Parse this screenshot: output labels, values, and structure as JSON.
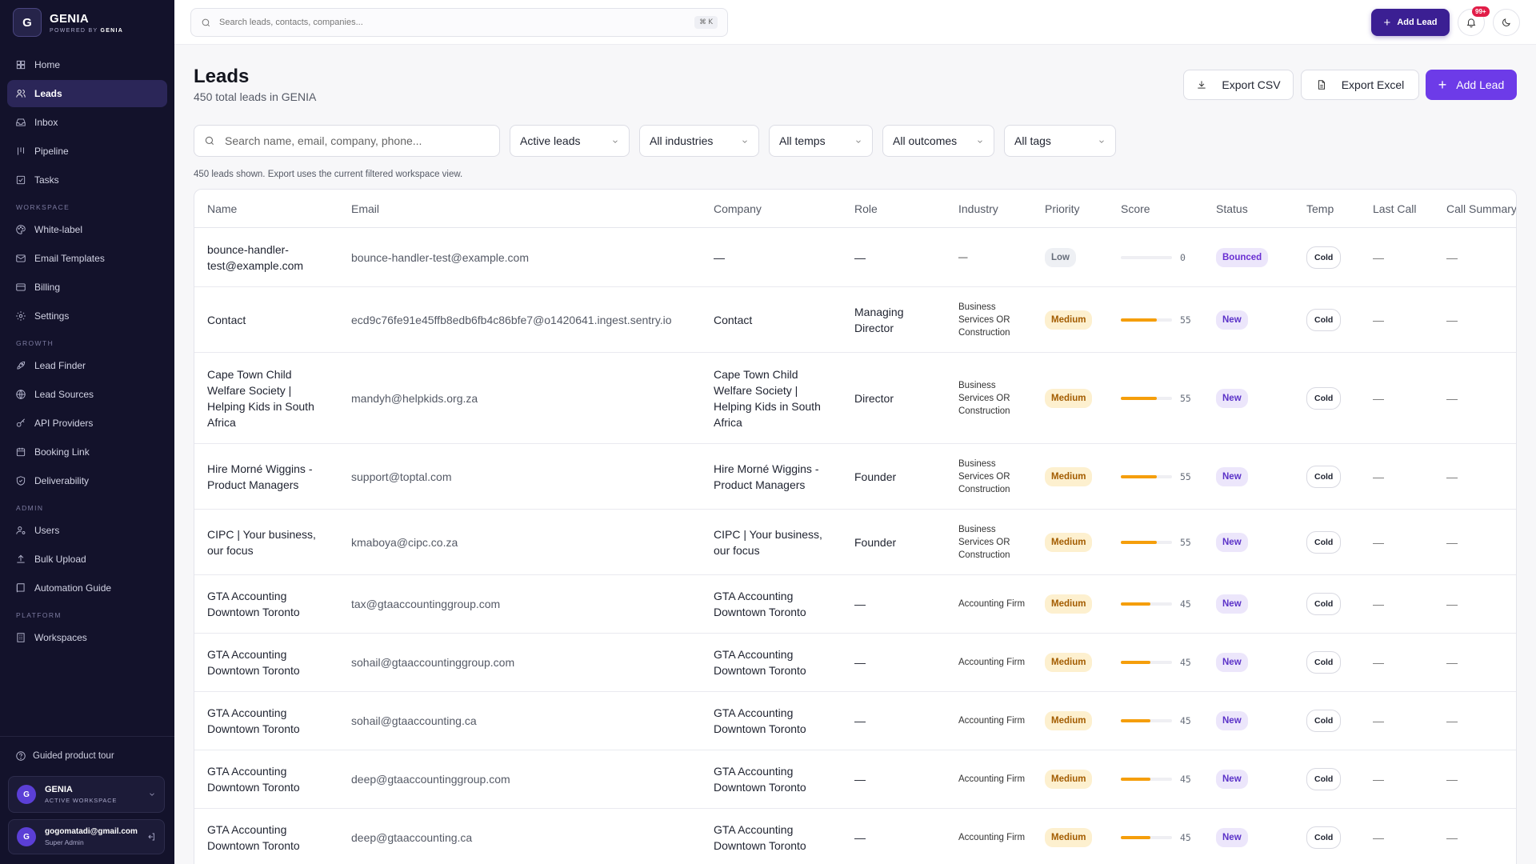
{
  "brand": {
    "logo_letter": "G",
    "name": "GENIA",
    "powered_by": "POWERED BY",
    "powered_brand": "GENIA"
  },
  "nav": {
    "main": [
      {
        "label": "Home",
        "icon": "grid-icon"
      },
      {
        "label": "Leads",
        "icon": "users-icon",
        "active": true
      },
      {
        "label": "Inbox",
        "icon": "inbox-icon"
      },
      {
        "label": "Pipeline",
        "icon": "pipeline-icon"
      },
      {
        "label": "Tasks",
        "icon": "task-check-icon"
      }
    ],
    "sections": [
      {
        "title": "WORKSPACE",
        "items": [
          {
            "label": "White-label",
            "icon": "palette-icon"
          },
          {
            "label": "Email Templates",
            "icon": "mail-icon"
          },
          {
            "label": "Billing",
            "icon": "card-icon"
          },
          {
            "label": "Settings",
            "icon": "gear-icon"
          }
        ]
      },
      {
        "title": "GROWTH",
        "items": [
          {
            "label": "Lead Finder",
            "icon": "rocket-icon"
          },
          {
            "label": "Lead Sources",
            "icon": "globe-icon"
          },
          {
            "label": "API Providers",
            "icon": "key-icon"
          },
          {
            "label": "Booking Link",
            "icon": "calendar-icon"
          },
          {
            "label": "Deliverability",
            "icon": "shield-icon"
          }
        ]
      },
      {
        "title": "ADMIN",
        "items": [
          {
            "label": "Users",
            "icon": "user-cog-icon"
          },
          {
            "label": "Bulk Upload",
            "icon": "upload-icon"
          },
          {
            "label": "Automation Guide",
            "icon": "book-icon"
          }
        ]
      },
      {
        "title": "PLATFORM",
        "items": [
          {
            "label": "Workspaces",
            "icon": "building-icon"
          }
        ]
      }
    ]
  },
  "sidebar_footer": {
    "tour_label": "Guided product tour",
    "workspace": {
      "avatar": "G",
      "name": "GENIA",
      "sub": "ACTIVE WORKSPACE"
    },
    "user": {
      "avatar": "G",
      "email": "gogomatadi@gmail.com",
      "role": "Super Admin"
    }
  },
  "topbar": {
    "search_placeholder": "Search leads, contacts, companies...",
    "shortcut": "⌘ K",
    "add_lead": "Add Lead",
    "notif_badge": "99+"
  },
  "page": {
    "title": "Leads",
    "subtitle": "450 total leads in GENIA",
    "export_csv": "Export CSV",
    "export_excel": "Export Excel",
    "add_lead": "Add Lead",
    "search_placeholder": "Search name, email, company, phone...",
    "filters": [
      "Active leads",
      "All industries",
      "All temps",
      "All outcomes",
      "All tags"
    ],
    "hint": "450 leads shown. Export uses the current filtered workspace view."
  },
  "table": {
    "columns": [
      "Name",
      "Email",
      "Company",
      "Role",
      "Industry",
      "Priority",
      "Score",
      "Status",
      "Temp",
      "Last Call",
      "Call Summary"
    ],
    "rows": [
      {
        "name": "bounce-handler-test@example.com",
        "email": "bounce-handler-test@example.com",
        "company": "—",
        "role": "—",
        "industry": "—",
        "priority": "Low",
        "score": 0,
        "status": "Bounced",
        "temp": "Cold",
        "last_call": "—",
        "summary": "—"
      },
      {
        "name": "Contact",
        "email": "ecd9c76fe91e45ffb8edb6fb4c86bfe7@o1420641.ingest.sentry.io",
        "company": "Contact",
        "role": "Managing Director",
        "industry": "Business Services OR Construction",
        "priority": "Medium",
        "score": 55,
        "status": "New",
        "temp": "Cold",
        "last_call": "—",
        "summary": "—"
      },
      {
        "name": "Cape Town Child Welfare Society | Helping Kids in South Africa",
        "email": "mandyh@helpkids.org.za",
        "company": "Cape Town Child Welfare Society | Helping Kids in South Africa",
        "role": "Director",
        "industry": "Business Services OR Construction",
        "priority": "Medium",
        "score": 55,
        "status": "New",
        "temp": "Cold",
        "last_call": "—",
        "summary": "—"
      },
      {
        "name": "Hire Morné Wiggins - Product Managers",
        "email": "support@toptal.com",
        "company": "Hire Morné Wiggins - Product Managers",
        "role": "Founder",
        "industry": "Business Services OR Construction",
        "priority": "Medium",
        "score": 55,
        "status": "New",
        "temp": "Cold",
        "last_call": "—",
        "summary": "—"
      },
      {
        "name": "CIPC | Your business, our focus",
        "email": "kmaboya@cipc.co.za",
        "company": "CIPC | Your business, our focus",
        "role": "Founder",
        "industry": "Business Services OR Construction",
        "priority": "Medium",
        "score": 55,
        "status": "New",
        "temp": "Cold",
        "last_call": "—",
        "summary": "—"
      },
      {
        "name": "GTA Accounting Downtown Toronto",
        "email": "tax@gtaaccountinggroup.com",
        "company": "GTA Accounting Downtown Toronto",
        "role": "—",
        "industry": "Accounting Firm",
        "priority": "Medium",
        "score": 45,
        "status": "New",
        "temp": "Cold",
        "last_call": "—",
        "summary": "—"
      },
      {
        "name": "GTA Accounting Downtown Toronto",
        "email": "sohail@gtaaccountinggroup.com",
        "company": "GTA Accounting Downtown Toronto",
        "role": "—",
        "industry": "Accounting Firm",
        "priority": "Medium",
        "score": 45,
        "status": "New",
        "temp": "Cold",
        "last_call": "—",
        "summary": "—"
      },
      {
        "name": "GTA Accounting Downtown Toronto",
        "email": "sohail@gtaaccounting.ca",
        "company": "GTA Accounting Downtown Toronto",
        "role": "—",
        "industry": "Accounting Firm",
        "priority": "Medium",
        "score": 45,
        "status": "New",
        "temp": "Cold",
        "last_call": "—",
        "summary": "—"
      },
      {
        "name": "GTA Accounting Downtown Toronto",
        "email": "deep@gtaaccountinggroup.com",
        "company": "GTA Accounting Downtown Toronto",
        "role": "—",
        "industry": "Accounting Firm",
        "priority": "Medium",
        "score": 45,
        "status": "New",
        "temp": "Cold",
        "last_call": "—",
        "summary": "—"
      },
      {
        "name": "GTA Accounting Downtown Toronto",
        "email": "deep@gtaaccounting.ca",
        "company": "GTA Accounting Downtown Toronto",
        "role": "—",
        "industry": "Accounting Firm",
        "priority": "Medium",
        "score": 45,
        "status": "New",
        "temp": "Cold",
        "last_call": "—",
        "summary": "—"
      }
    ]
  },
  "colors": {
    "sidebar_bg": "#13122b",
    "accent": "#6d3be8",
    "score_bar": "#f59e0b",
    "medium": "#a35c00"
  }
}
